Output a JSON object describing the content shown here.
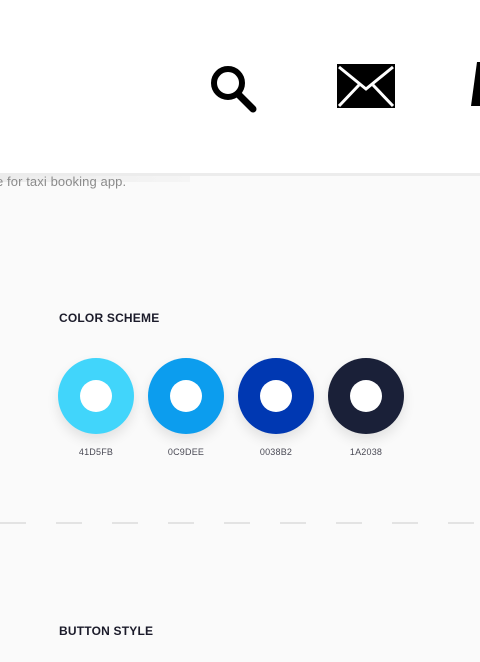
{
  "header": {
    "icons": [
      {
        "name": "search-icon",
        "color": "#000000"
      },
      {
        "name": "mail-icon",
        "color": "#000000"
      },
      {
        "name": "partial-icon",
        "color": "#000000"
      }
    ]
  },
  "intro": {
    "subtitle": "e for taxi booking app."
  },
  "color_scheme": {
    "heading": "COLOR SCHEME",
    "swatches": [
      {
        "label": "41D5FB",
        "color": "#41D5FB"
      },
      {
        "label": "0C9DEE",
        "color": "#0C9DEE"
      },
      {
        "label": "0038B2",
        "color": "#0038B2"
      },
      {
        "label": "1A2038",
        "color": "#1A2038"
      }
    ]
  },
  "button_style": {
    "heading": "BUTTON STYLE"
  }
}
